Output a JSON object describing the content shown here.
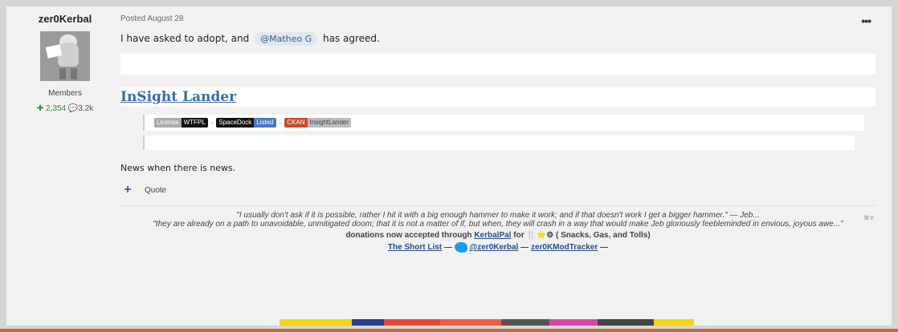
{
  "author": {
    "name": "zer0Kerbal",
    "rank": "Members",
    "reputation": "2,354",
    "posts": "3.2k"
  },
  "post": {
    "posted": "Posted August 28",
    "line1_before": "I have asked to adopt, and",
    "mention": "@Matheo G",
    "line1_after": "has agreed.",
    "title": "InSight Lander",
    "badges": {
      "license_label": "License",
      "license_value": "WTFPL",
      "spacedock_label": "SpaceDock",
      "spacedock_value": "Listed",
      "ckan_label": "CKAN",
      "ckan_value": "InsightLander"
    },
    "news": "News when there is news.",
    "quote_label": "Quote"
  },
  "signature": {
    "quote1": "\"I usually don't ask if it is possible, rather I hit it with a big enough hammer to make it work; and if that doesn't work I get a bigger hammer.\"  — Jeb...",
    "quote2": "\"they are already on a path to unavoidable, unmitigated doom; that it is not a matter of if, but when, they will crash in a way that would make Jeb gloriously feebleminded in envious, joyous awe...\"",
    "donations_before": "donations now accepted through",
    "kerbalpal": "KerbalPal",
    "donations_after": "for",
    "donations_tail": "( Snacks, Gas, and Tolls)",
    "short_list": "The Short List",
    "twitter": "@zer0Kerbal",
    "tracker": "zer0KModTracker",
    "sep": "—"
  },
  "colors": {
    "accent": "#3a6aa8",
    "reputation": "#3b8a3b"
  }
}
